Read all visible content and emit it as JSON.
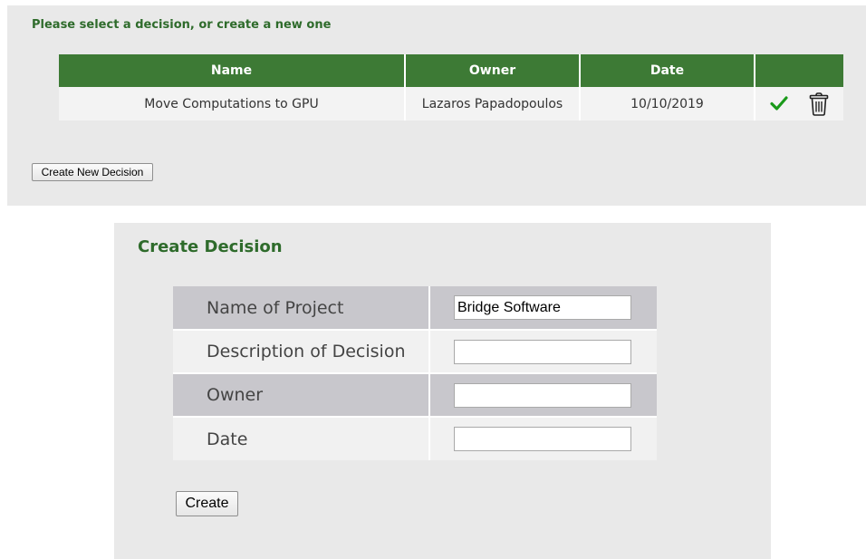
{
  "decision_list": {
    "heading": "Please select a decision, or create a new one",
    "columns": [
      "Name",
      "Owner",
      "Date",
      ""
    ],
    "rows": [
      {
        "name": "Move Computations to GPU",
        "owner": "Lazaros Papadopoulos",
        "date": "10/10/2019"
      }
    ],
    "create_new_label": "Create New Decision"
  },
  "create_form": {
    "heading": "Create Decision",
    "fields": [
      {
        "label": "Name of Project",
        "value": "Bridge Software"
      },
      {
        "label": "Description of Decision",
        "value": ""
      },
      {
        "label": "Owner",
        "value": ""
      },
      {
        "label": "Date",
        "value": ""
      }
    ],
    "submit_label": "Create"
  },
  "colors": {
    "accent_green": "#3d7a35",
    "heading_green": "#2e6b2b",
    "check_green": "#1a9a1a"
  },
  "icons": [
    "check-icon",
    "trash-icon"
  ]
}
